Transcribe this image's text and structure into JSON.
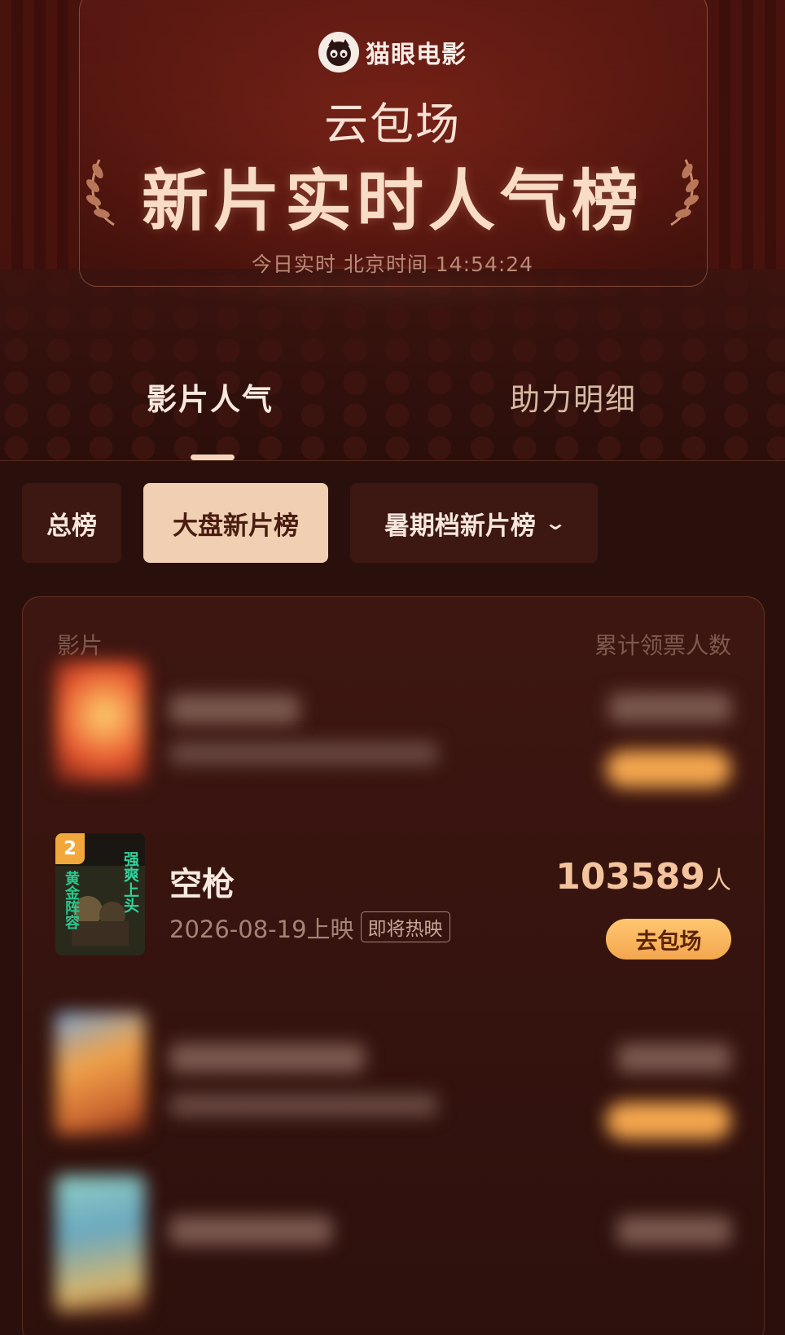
{
  "hero": {
    "brand": "猫眼电影",
    "subtitle": "云包场",
    "title": "新片实时人气榜",
    "time_label": "今日实时 北京时间 14:54:24"
  },
  "tabs": [
    {
      "label": "影片人气",
      "active": true
    },
    {
      "label": "助力明细",
      "active": false
    }
  ],
  "chips": [
    {
      "label": "总榜",
      "selected": false
    },
    {
      "label": "大盘新片榜",
      "selected": true
    },
    {
      "label": "暑期档新片榜",
      "selected": false,
      "has_dropdown": true
    }
  ],
  "list": {
    "col_film": "影片",
    "col_count": "累计领票人数",
    "items": [
      {
        "rank": 2,
        "title": "空枪",
        "release": "2026-08-19上映",
        "status": "即将热映",
        "count": "103589",
        "unit": "人",
        "button": "去包场",
        "poster_text": [
          "强爽上头",
          "黄金阵容"
        ]
      }
    ]
  },
  "colors": {
    "accent": "#f3a64e",
    "chip_selected": "#f1cfb2",
    "background": "#2a100c"
  }
}
